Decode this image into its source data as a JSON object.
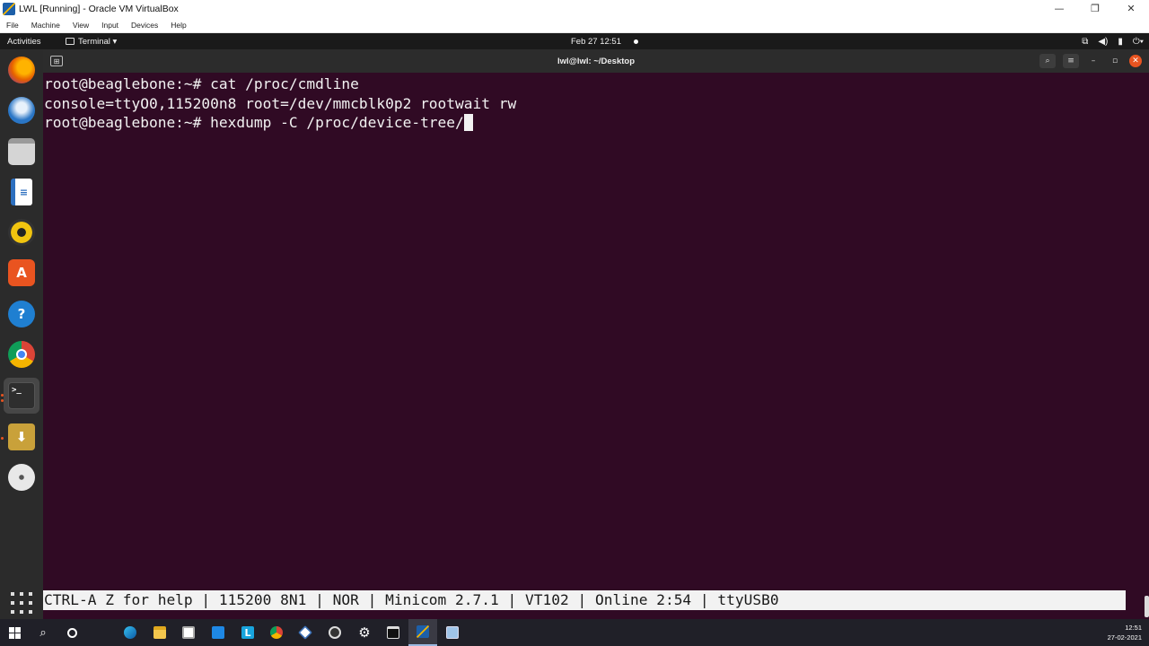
{
  "host": {
    "title": "LWL [Running] - Oracle VM VirtualBox",
    "menu": [
      "File",
      "Machine",
      "View",
      "Input",
      "Devices",
      "Help"
    ],
    "controls": {
      "minimize": "—",
      "restore": "❐",
      "close": "✕"
    }
  },
  "gnome": {
    "activities": "Activities",
    "app_menu": "Terminal ▾",
    "clock": "Feb 27  12:51",
    "tray": [
      "network-icon",
      "volume-icon",
      "battery-icon",
      "power-icon"
    ]
  },
  "dock": {
    "items": [
      {
        "name": "firefox-icon",
        "color": "#e66000"
      },
      {
        "name": "thunderbird-icon",
        "color": "#2a76c6"
      },
      {
        "name": "files-icon",
        "color": "#d5d5d5"
      },
      {
        "name": "libreoffice-writer-icon",
        "color": "#2c6fbf"
      },
      {
        "name": "rhythmbox-icon",
        "color": "#f1c40f"
      },
      {
        "name": "ubuntu-software-icon",
        "color": "#e95420"
      },
      {
        "name": "help-icon",
        "color": "#1f7fd1"
      },
      {
        "name": "chrome-icon",
        "color": "#db4437"
      },
      {
        "name": "terminal-icon",
        "color": "#2e2e2e"
      },
      {
        "name": "install-icon",
        "color": "#c9a13a"
      },
      {
        "name": "dvd-icon",
        "color": "#d0d0d0"
      }
    ]
  },
  "terminal": {
    "header_title": "lwl@lwl: ~/Desktop",
    "new_tab": "⊞",
    "lines": [
      "root@beaglebone:~# cat /proc/cmdline",
      "console=ttyO0,115200n8 root=/dev/mmcblk0p2 rootwait rw"
    ],
    "prompt_line": "root@beaglebone:~# hexdump -C /proc/device-tree/",
    "status_bar": "CTRL-A Z for help | 115200 8N1 | NOR | Minicom 2.7.1 | VT102 | Online 2:54 | ttyUSB0"
  },
  "taskbar": {
    "time": "12:51",
    "date": "27-02-2021",
    "items": [
      "start-icon",
      "search-icon",
      "task-view-icon",
      "edge-icon",
      "file-explorer-icon",
      "store-icon",
      "mail-icon",
      "libreoffice-icon",
      "chrome-icon",
      "virtualbox-icon",
      "obs-icon",
      "settings-icon",
      "terminal-app-icon",
      "virtualbox-running-icon",
      "network-app-icon"
    ]
  }
}
